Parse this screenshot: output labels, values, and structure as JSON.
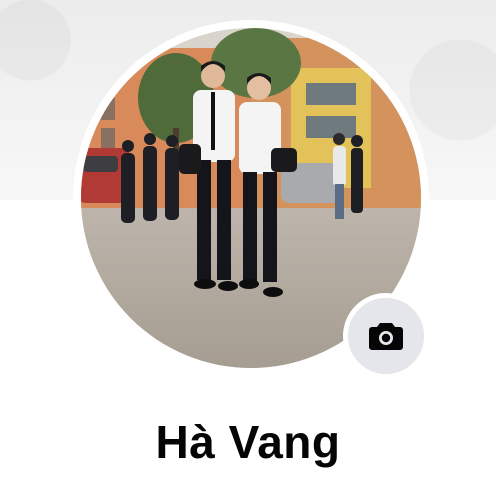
{
  "profile": {
    "name": "Hà Vang"
  },
  "cover_photo": {
    "description_icon": "cover-photo"
  },
  "avatar": {
    "icon": "profile-photo"
  },
  "camera_button": {
    "icon": "camera-icon"
  },
  "colors": {
    "camera_button_bg": "#e4e6eb",
    "name_text": "#050505",
    "page_bg": "#ffffff"
  }
}
